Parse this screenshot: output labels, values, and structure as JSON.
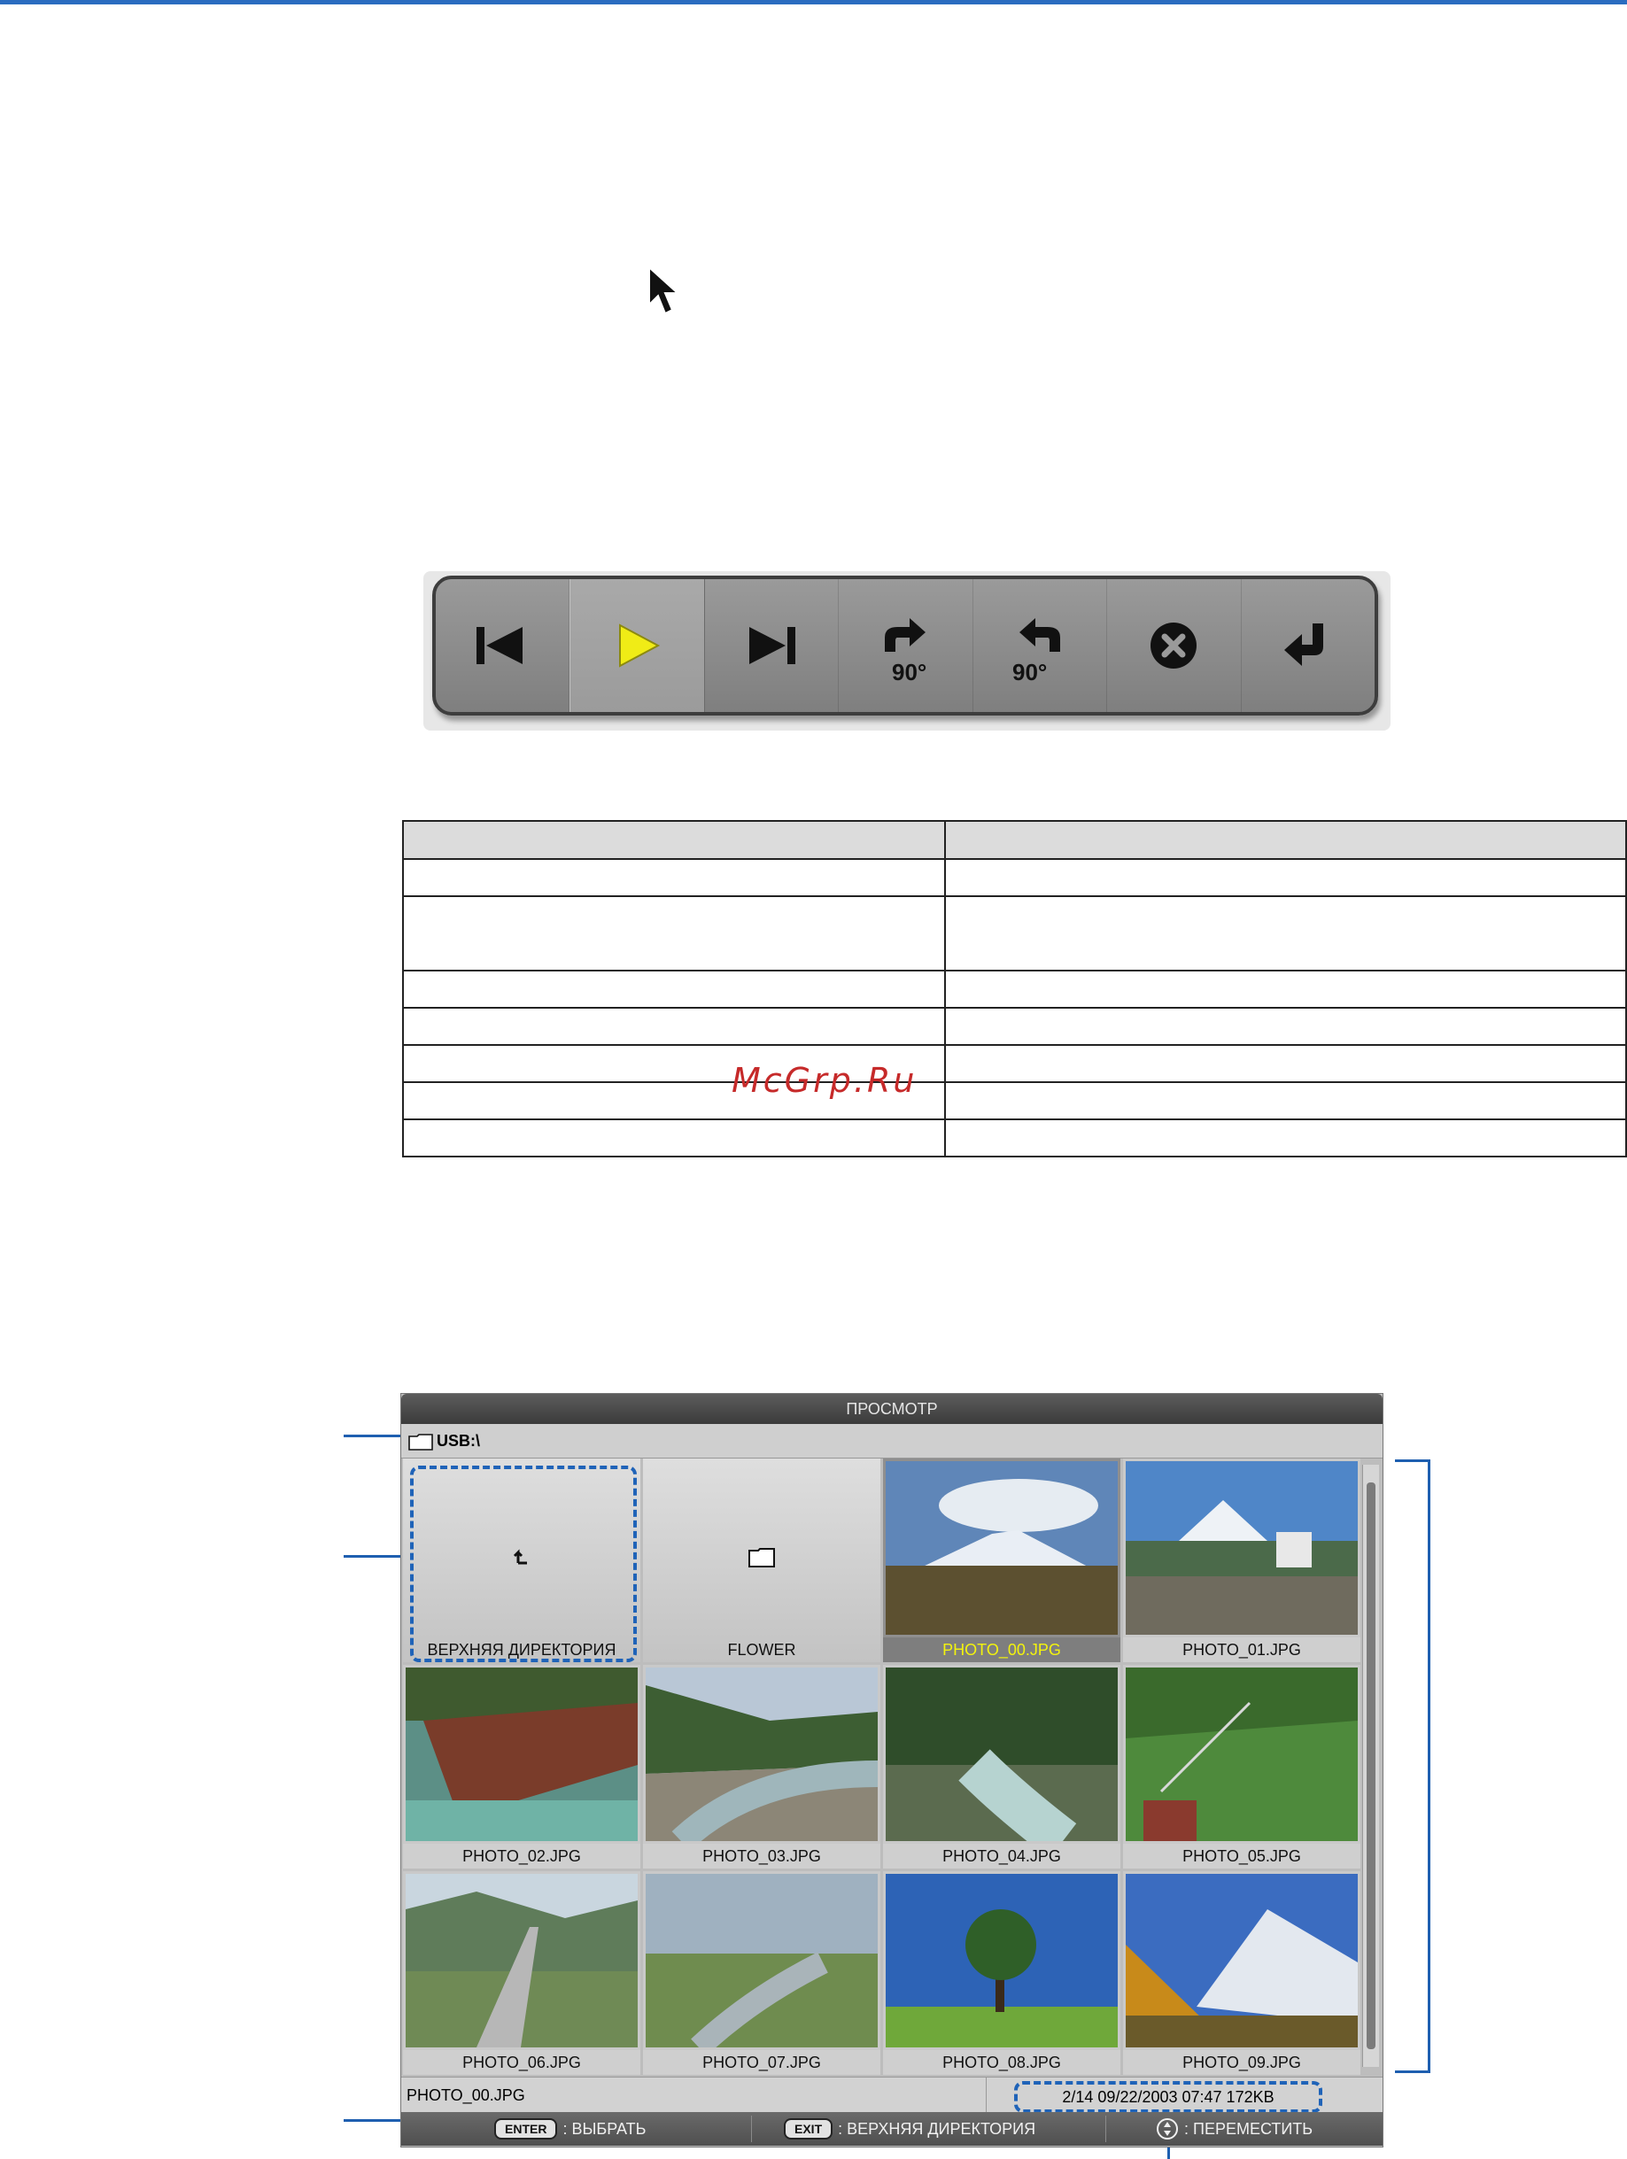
{
  "control_bar": {
    "buttons": [
      {
        "icon": "skip-back-icon"
      },
      {
        "icon": "play-icon",
        "selected": true
      },
      {
        "icon": "skip-forward-icon"
      },
      {
        "icon": "rotate-right-icon",
        "label": "90°"
      },
      {
        "icon": "rotate-left-icon",
        "label": "90°"
      },
      {
        "icon": "close-icon"
      },
      {
        "icon": "return-icon"
      }
    ]
  },
  "table": {
    "header": [
      "",
      ""
    ],
    "rows": [
      [
        "",
        ""
      ],
      [
        "",
        ""
      ],
      [
        "",
        ""
      ],
      [
        "",
        ""
      ],
      [
        "",
        ""
      ],
      [
        "",
        ""
      ],
      [
        "",
        ""
      ]
    ]
  },
  "watermark": "McGrp.Ru",
  "viewer": {
    "title": "ПРОСМОТР",
    "path": "USB:\\",
    "tiles": [
      {
        "caption": "ВЕРХНЯЯ ДИРЕКТОРИЯ",
        "type": "up-folder"
      },
      {
        "caption": "FLOWER",
        "type": "folder"
      },
      {
        "caption": "PHOTO_00.JPG",
        "type": "photo",
        "selected": true
      },
      {
        "caption": "PHOTO_01.JPG",
        "type": "photo"
      },
      {
        "caption": "PHOTO_02.JPG",
        "type": "photo"
      },
      {
        "caption": "PHOTO_03.JPG",
        "type": "photo"
      },
      {
        "caption": "PHOTO_04.JPG",
        "type": "photo"
      },
      {
        "caption": "PHOTO_05.JPG",
        "type": "photo"
      },
      {
        "caption": "PHOTO_06.JPG",
        "type": "photo"
      },
      {
        "caption": "PHOTO_07.JPG",
        "type": "photo"
      },
      {
        "caption": "PHOTO_08.JPG",
        "type": "photo"
      },
      {
        "caption": "PHOTO_09.JPG",
        "type": "photo"
      }
    ],
    "status": {
      "filename": "PHOTO_00.JPG",
      "info": "2/14  09/22/2003 07:47  172KB"
    },
    "help": [
      {
        "key": "ENTER",
        "text": ": ВЫБРАТЬ"
      },
      {
        "key": "EXIT",
        "text": ": ВЕРХНЯЯ ДИРЕКТОРИЯ"
      },
      {
        "key": "",
        "text": ": ПЕРЕМЕСТИТЬ"
      }
    ]
  },
  "colors": {
    "accent_blue": "#1f63b8",
    "selected_caption": "#f3f30d",
    "watermark_red": "#c62a2a"
  }
}
